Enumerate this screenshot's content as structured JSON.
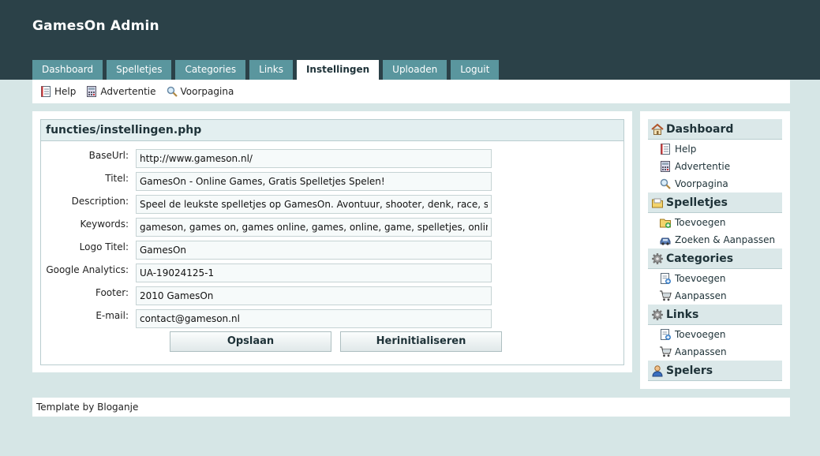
{
  "app": {
    "title": "GamesOn Admin"
  },
  "tabs": [
    {
      "label": "Dashboard",
      "active": false
    },
    {
      "label": "Spelletjes",
      "active": false
    },
    {
      "label": "Categories",
      "active": false
    },
    {
      "label": "Links",
      "active": false
    },
    {
      "label": "Instellingen",
      "active": true
    },
    {
      "label": "Uploaden",
      "active": false
    },
    {
      "label": "Loguit",
      "active": false
    }
  ],
  "subnav": [
    {
      "label": "Help",
      "icon": "document-icon"
    },
    {
      "label": "Advertentie",
      "icon": "calculator-icon"
    },
    {
      "label": "Voorpagina",
      "icon": "magnifier-icon"
    }
  ],
  "form": {
    "title": "functies/instellingen.php",
    "fields": [
      {
        "label": "BaseUrl:",
        "value": "http://www.gameson.nl/"
      },
      {
        "label": "Titel:",
        "value": "GamesOn - Online Games, Gratis Spelletjes Spelen!"
      },
      {
        "label": "Description:",
        "value": "Speel de leukste spelletjes op GamesOn. Avontuur, shooter, denk, race, sport"
      },
      {
        "label": "Keywords:",
        "value": "gameson, games on, games online, games, online, game, spelletjes, online"
      },
      {
        "label": "Logo Titel:",
        "value": "GamesOn"
      },
      {
        "label": "Google Analytics:",
        "value": "UA-19024125-1"
      },
      {
        "label": "Footer:",
        "value": "2010 GamesOn"
      },
      {
        "label": "E-mail:",
        "value": "contact@gameson.nl"
      }
    ],
    "save_label": "Opslaan",
    "reset_label": "Herinitialiseren"
  },
  "sidebar": {
    "sections": [
      {
        "label": "Dashboard",
        "icon": "home-icon",
        "items": [
          {
            "label": "Help",
            "icon": "document-icon"
          },
          {
            "label": "Advertentie",
            "icon": "calculator-icon"
          },
          {
            "label": "Voorpagina",
            "icon": "magnifier-icon"
          }
        ]
      },
      {
        "label": "Spelletjes",
        "icon": "folder-icon",
        "items": [
          {
            "label": "Toevoegen",
            "icon": "add-folder-icon"
          },
          {
            "label": "Zoeken & Aanpassen",
            "icon": "car-icon"
          }
        ]
      },
      {
        "label": "Categories",
        "icon": "gear-icon",
        "items": [
          {
            "label": "Toevoegen",
            "icon": "add-page-icon"
          },
          {
            "label": "Aanpassen",
            "icon": "cart-icon"
          }
        ]
      },
      {
        "label": "Links",
        "icon": "gear-icon",
        "items": [
          {
            "label": "Toevoegen",
            "icon": "add-page-icon"
          },
          {
            "label": "Aanpassen",
            "icon": "cart-icon"
          }
        ]
      },
      {
        "label": "Spelers",
        "icon": "user-icon",
        "items": []
      }
    ]
  },
  "footer": {
    "prefix": "Template",
    "by": "by",
    "author": "Bloganje"
  }
}
